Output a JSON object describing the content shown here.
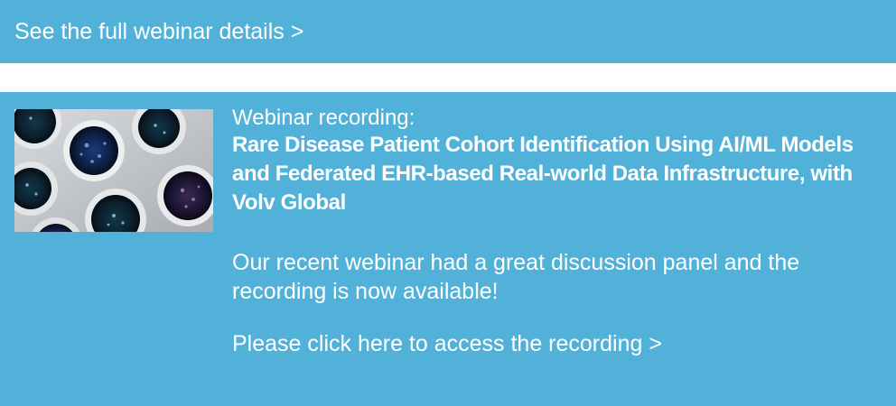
{
  "banner": {
    "link_label": "See the full webinar details >"
  },
  "webinar": {
    "kicker": "Webinar recording:",
    "title": "Rare Disease Patient Cohort Identification Using AI/ML Models and Federated EHR-based Real-world Data Infrastructure, with Volv Global",
    "description": "Our recent webinar had a great discussion panel and the recording is now available!",
    "cta_label": "Please click here to access the recording >"
  },
  "colors": {
    "background_blue": "#52b1d9",
    "text": "#ffffff",
    "divider": "#ffffff"
  }
}
